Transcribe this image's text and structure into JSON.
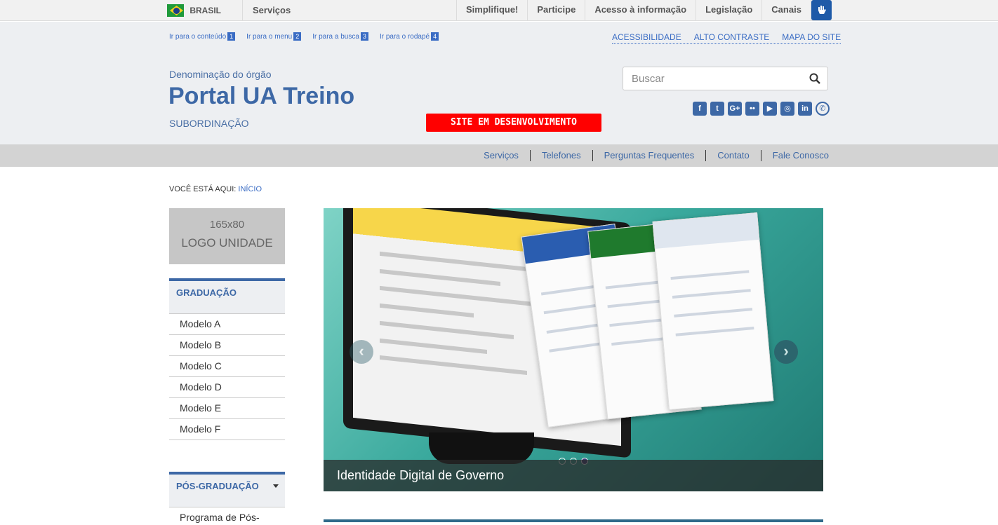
{
  "govbar": {
    "country": "BRASIL",
    "services": "Serviços",
    "links": [
      "Simplifique!",
      "Participe",
      "Acesso à informação",
      "Legislação",
      "Canais"
    ]
  },
  "skip_links": [
    {
      "label": "Ir para o conteúdo",
      "num": "1"
    },
    {
      "label": "Ir para o menu",
      "num": "2"
    },
    {
      "label": "Ir para a busca",
      "num": "3"
    },
    {
      "label": "Ir para o rodapé",
      "num": "4"
    }
  ],
  "accessibility": [
    "ACESSIBILIDADE",
    "ALTO CONTRASTE",
    "MAPA DO SITE"
  ],
  "header": {
    "denomination": "Denominação do órgão",
    "title": "Portal UA Treino",
    "subordination": "SUBORDINAÇÃO",
    "dev_badge": "SITE EM DESENVOLVIMENTO"
  },
  "search": {
    "placeholder": "Buscar"
  },
  "social_icons": [
    "facebook-icon",
    "twitter-icon",
    "google-plus-icon",
    "flickr-icon",
    "youtube-icon",
    "instagram-icon",
    "linkedin-icon",
    "whatsapp-icon"
  ],
  "service_nav": [
    "Serviços",
    "Telefones",
    "Perguntas Frequentes",
    "Contato",
    "Fale Conosco"
  ],
  "breadcrumb": {
    "prefix": "VOCÊ ESTÁ AQUI:",
    "home": "INÍCIO"
  },
  "logo_placeholder": {
    "size": "165x80",
    "label": "LOGO UNIDADE"
  },
  "sidebar": {
    "graduacao": {
      "title": "GRADUAÇÃO",
      "items": [
        "Modelo A",
        "Modelo B",
        "Modelo C",
        "Modelo D",
        "Modelo E",
        "Modelo F"
      ]
    },
    "pos": {
      "title": "PÓS-GRADUAÇÃO",
      "items": [
        "Programa de Pós-"
      ]
    }
  },
  "carousel": {
    "caption": "Identidade Digital de Governo",
    "slides": 3,
    "active_slide": 3
  },
  "colors": {
    "brand": "#3d68a6",
    "badge": "#ff0000",
    "govbar_bg": "#f1f1f1"
  }
}
